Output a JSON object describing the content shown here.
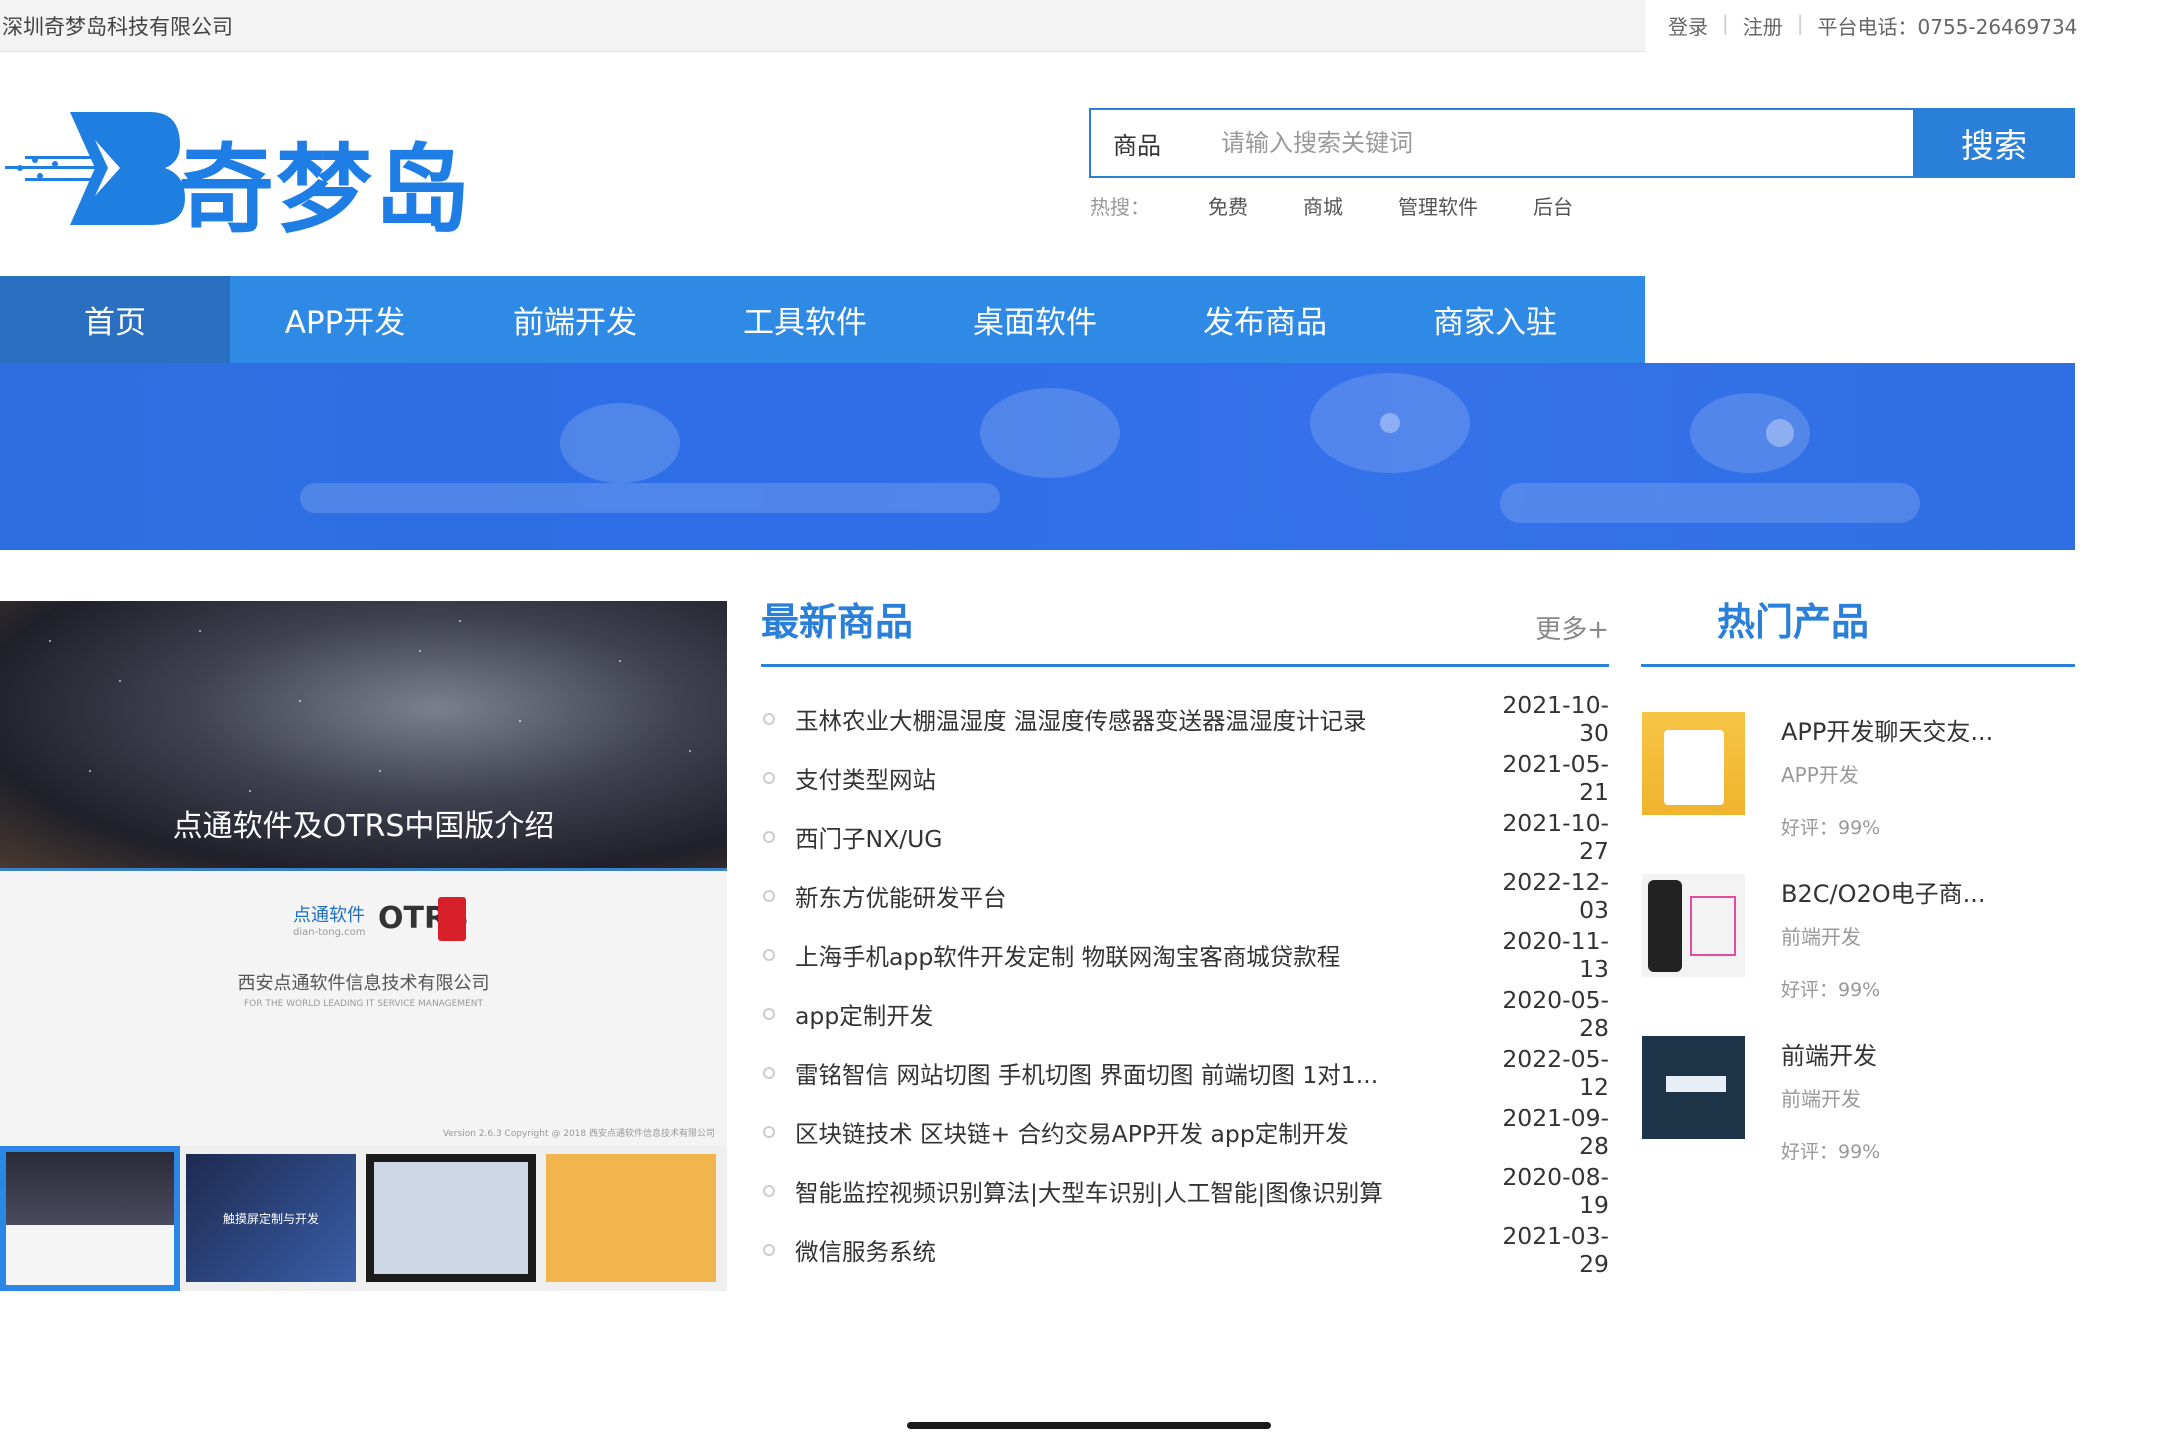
{
  "topbar": {
    "company": "深圳奇梦岛科技有限公司",
    "login": "登录",
    "register": "注册",
    "phone": "平台电话：0755-26469734"
  },
  "logo": {
    "text": "奇梦岛"
  },
  "search": {
    "category": "商品",
    "placeholder": "请输入搜索关键词",
    "button": "搜索",
    "hot_label": "热搜：",
    "hot_keywords": [
      "免费",
      "商城",
      "管理软件",
      "后台"
    ]
  },
  "nav": {
    "items": [
      "首页",
      "APP开发",
      "前端开发",
      "工具软件",
      "桌面软件",
      "发布商品",
      "商家入驻"
    ],
    "active_index": 0
  },
  "gallery": {
    "slide_title": "点通软件及OTRS中国版介绍",
    "brand_cn": "点通软件",
    "brand_en": "dian-tong.com",
    "brand_otrs": "OTRS",
    "company": "西安点通软件信息技术有限公司",
    "tagline": "FOR THE WORLD LEADING IT SERVICE MANAGEMENT",
    "version": "Version 2.6.3  Copyright @ 2018 西安点通软件信息技术有限公司",
    "thumb2_text": "触摸屏定制与开发"
  },
  "latest": {
    "title": "最新商品",
    "more": "更多+",
    "items": [
      {
        "title": "玉林农业大棚温湿度 温湿度传感器变送器温湿度计记录",
        "date": "2021-10-30"
      },
      {
        "title": "支付类型网站",
        "date": "2021-05-21"
      },
      {
        "title": "西门子NX/UG",
        "date": "2021-10-27"
      },
      {
        "title": "新东方优能研发平台",
        "date": "2022-12-03"
      },
      {
        "title": "上海手机app软件开发定制 物联网淘宝客商城贷款程",
        "date": "2020-11-13"
      },
      {
        "title": "app定制开发",
        "date": "2020-05-28"
      },
      {
        "title": "雷铭智信 网站切图 手机切图 界面切图 前端切图 1对1...",
        "date": "2022-05-12"
      },
      {
        "title": "区块链技术 区块链+ 合约交易APP开发 app定制开发",
        "date": "2021-09-28"
      },
      {
        "title": "智能监控视频识别算法|大型车识别|人工智能|图像识别算",
        "date": "2020-08-19"
      },
      {
        "title": "微信服务系统",
        "date": "2021-03-29"
      }
    ]
  },
  "hot_products": {
    "title": "热门产品",
    "items": [
      {
        "name": "APP开发聊天交友...",
        "category": "APP开发",
        "rating": "好评：99%"
      },
      {
        "name": "B2C/O2O电子商...",
        "category": "前端开发",
        "rating": "好评：99%"
      },
      {
        "name": "前端开发",
        "category": "前端开发",
        "rating": "好评：99%"
      }
    ]
  }
}
